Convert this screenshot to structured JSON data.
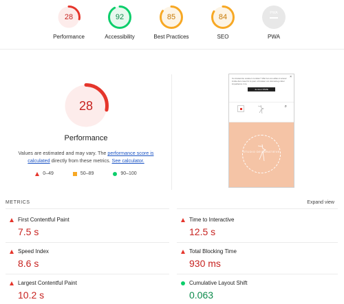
{
  "gauges": [
    {
      "label": "Performance",
      "score": "28",
      "fraction": 0.28,
      "color": "#e5352b",
      "bg": "#fdeceb"
    },
    {
      "label": "Accessibility",
      "score": "92",
      "fraction": 0.92,
      "color": "#0cce6b",
      "bg": "#e7f8ee"
    },
    {
      "label": "Best Practices",
      "score": "85",
      "fraction": 0.85,
      "color": "#f7a824",
      "bg": "#fdf4e5"
    },
    {
      "label": "SEO",
      "score": "84",
      "fraction": 0.84,
      "color": "#f7a824",
      "bg": "#fdf4e5"
    },
    {
      "label": "PWA",
      "score": "PWA"
    }
  ],
  "main": {
    "score": "28",
    "fraction": 0.28,
    "title": "Performance",
    "desc_prefix": "Values are estimated and may vary. The ",
    "desc_link1": "performance score is calculated",
    "desc_mid": " directly from these metrics. ",
    "desc_link2": "See calculator."
  },
  "legend": {
    "fail": "0–49",
    "average": "50–89",
    "pass": "90–100"
  },
  "preview": {
    "banner_text": "Cu trusted de cookie ti combat ? Wel zet ons willen d amour invitie dan cose hic is poor u browser om donnerieg cober impedience in te",
    "banner_button": "Je stuur PAME",
    "hero_text": "STUDIO DECORATIEVE"
  },
  "metrics": {
    "heading": "METRICS",
    "expand_label": "Expand view",
    "items": [
      {
        "name": "First Contentful Paint",
        "value": "7.5 s",
        "status": "fail"
      },
      {
        "name": "Time to Interactive",
        "value": "12.5 s",
        "status": "fail"
      },
      {
        "name": "Speed Index",
        "value": "8.6 s",
        "status": "fail"
      },
      {
        "name": "Total Blocking Time",
        "value": "930 ms",
        "status": "fail"
      },
      {
        "name": "Largest Contentful Paint",
        "value": "10.2 s",
        "status": "fail"
      },
      {
        "name": "Cumulative Layout Shift",
        "value": "0.063",
        "status": "pass"
      }
    ]
  }
}
